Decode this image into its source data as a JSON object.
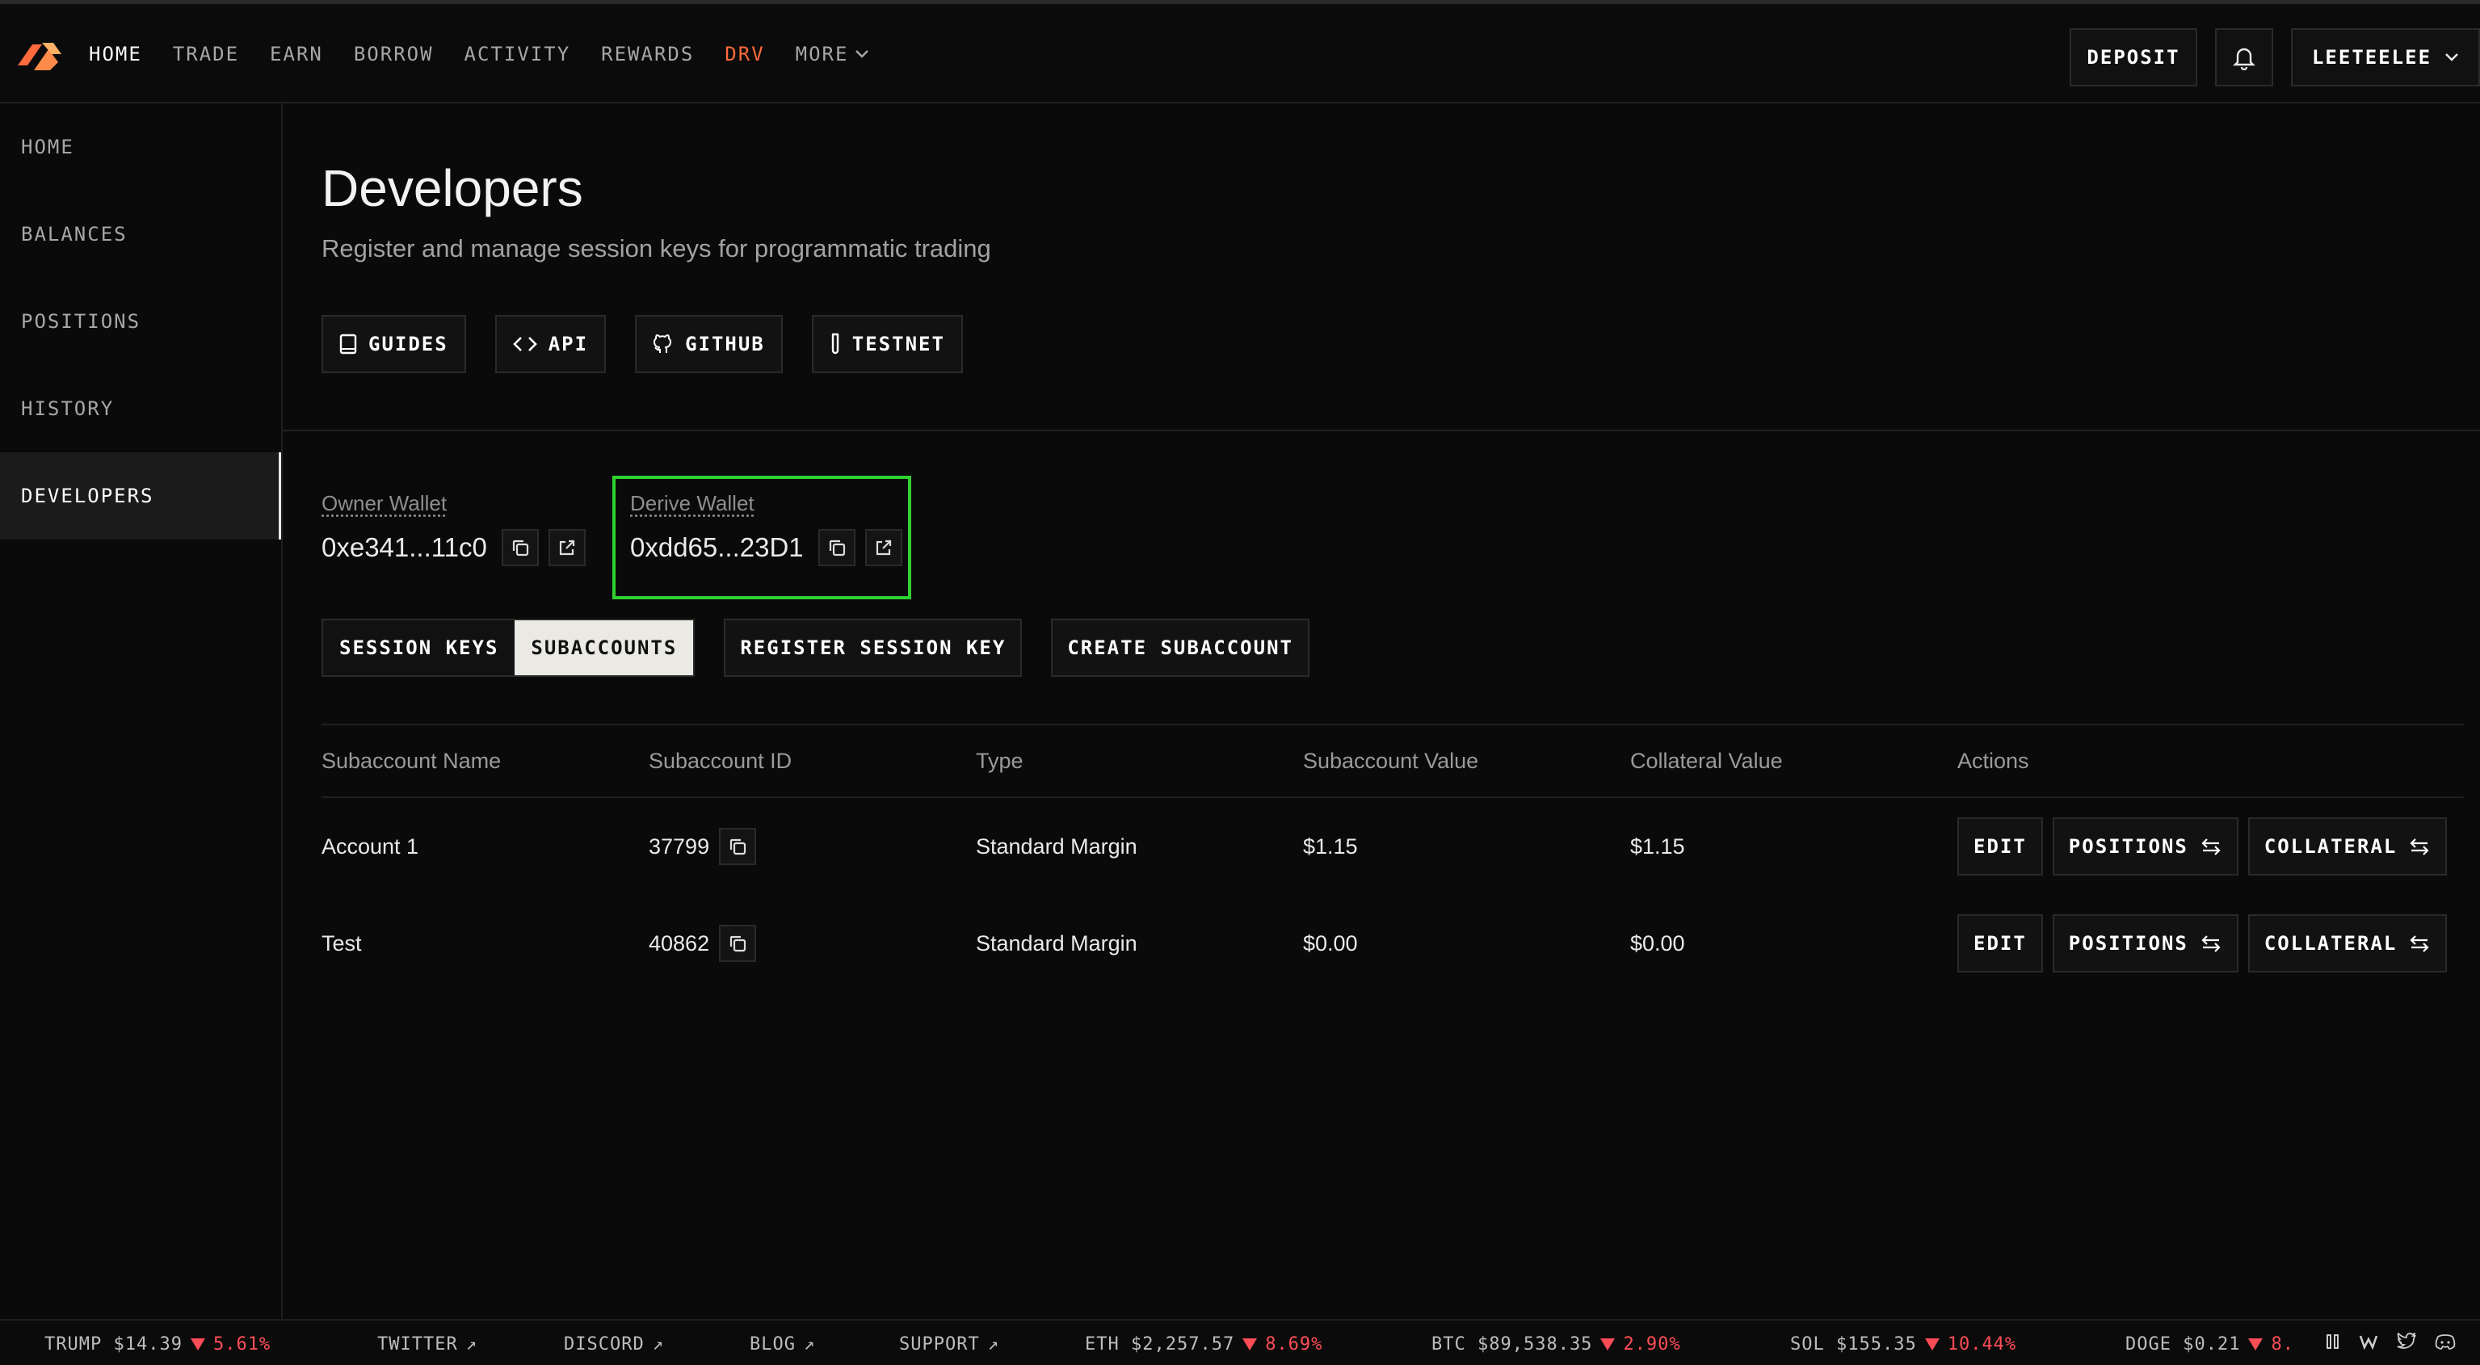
{
  "colors": {
    "accent": "#ff6a3d",
    "highlight": "#2fd12f",
    "negative": "#ff4d57"
  },
  "topnav": {
    "items": [
      "HOME",
      "TRADE",
      "EARN",
      "BORROW",
      "ACTIVITY",
      "REWARDS",
      "DRV"
    ],
    "more_label": "MORE",
    "deposit_label": "DEPOSIT",
    "account_label": "LEETEELEE"
  },
  "sidebar": {
    "items": [
      "HOME",
      "BALANCES",
      "POSITIONS",
      "HISTORY",
      "DEVELOPERS"
    ]
  },
  "page": {
    "title": "Developers",
    "subtitle": "Register and manage session keys for programmatic trading"
  },
  "doc_buttons": {
    "guides": "GUIDES",
    "api": "API",
    "github": "GITHUB",
    "testnet": "TESTNET"
  },
  "wallets": {
    "owner": {
      "label": "Owner Wallet",
      "address": "0xe341...11c0"
    },
    "derive": {
      "label": "Derive Wallet",
      "address": "0xdd65...23D1"
    }
  },
  "tabs": {
    "session_keys": "SESSION KEYS",
    "subaccounts": "SUBACCOUNTS"
  },
  "actions": {
    "register": "REGISTER SESSION KEY",
    "create": "CREATE SUBACCOUNT"
  },
  "table": {
    "headers": [
      "Subaccount Name",
      "Subaccount ID",
      "Type",
      "Subaccount Value",
      "Collateral Value",
      "Actions"
    ],
    "rows": [
      {
        "name": "Account 1",
        "id": "37799",
        "type": "Standard Margin",
        "sub_value": "$1.15",
        "coll_value": "$1.15"
      },
      {
        "name": "Test",
        "id": "40862",
        "type": "Standard Margin",
        "sub_value": "$0.00",
        "coll_value": "$0.00"
      }
    ],
    "btn_edit": "EDIT",
    "btn_positions": "POSITIONS",
    "btn_collateral": "COLLATERAL"
  },
  "ticker": {
    "trump": {
      "label": "TRUMP $14.39",
      "change": "5.61%"
    },
    "twitter": "TWITTER",
    "discord": "DISCORD",
    "blog": "BLOG",
    "support": "SUPPORT",
    "eth": {
      "label": "ETH $2,257.57",
      "change": "8.69%"
    },
    "btc": {
      "label": "BTC $89,538.35",
      "change": "2.90%"
    },
    "sol": {
      "label": "SOL $155.35",
      "change": "10.44%"
    },
    "doge": {
      "label": "DOGE $0.21",
      "change": "8."
    }
  }
}
